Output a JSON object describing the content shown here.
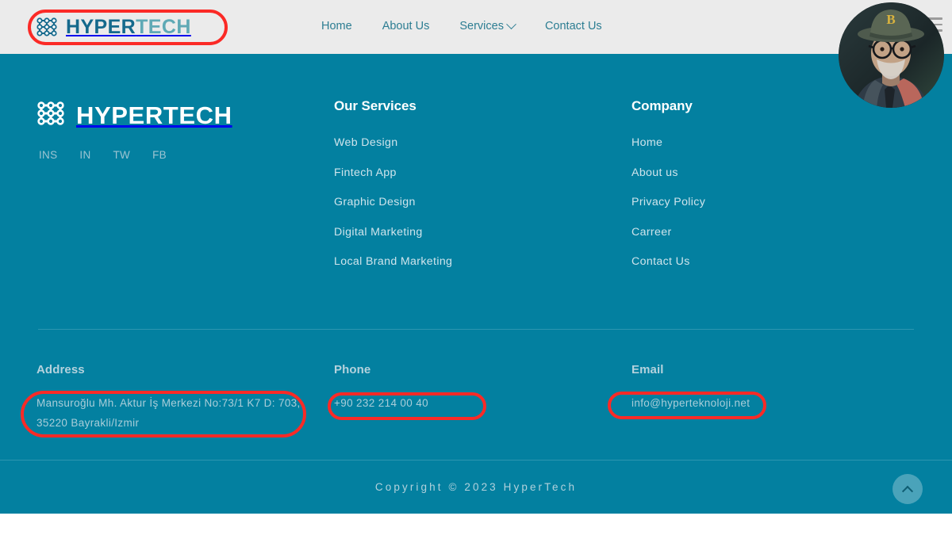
{
  "colors": {
    "header_bg": "#ebebeb",
    "footer_bg": "#0380a0",
    "brand_dark": "#15698c",
    "brand_light": "#5fa9b5",
    "nav_link": "#2c7d92",
    "annotation_red": "#fb2a26",
    "footer_link": "#cfe4ec",
    "divider": "#2d96b0",
    "totop_bg": "#4aa3ba"
  },
  "header": {
    "logo": {
      "icon": "node-grid-icon",
      "text_primary": "HYPER",
      "text_secondary": "TECH"
    },
    "nav": [
      {
        "label": "Home",
        "has_dropdown": false
      },
      {
        "label": "About Us",
        "has_dropdown": false
      },
      {
        "label": "Services",
        "has_dropdown": true,
        "caret": "chevron-down-icon"
      },
      {
        "label": "Contact Us",
        "has_dropdown": false
      }
    ],
    "menu_icon": "hamburger-menu-icon",
    "avatar": "user-avatar-elderly-man-with-glasses-and-hat"
  },
  "footer": {
    "brand": {
      "icon": "node-grid-icon",
      "text": "HYPERTECH"
    },
    "socials": [
      {
        "label": "INS",
        "name": "instagram-link"
      },
      {
        "label": "IN",
        "name": "linkedin-link"
      },
      {
        "label": "TW",
        "name": "twitter-link"
      },
      {
        "label": "FB",
        "name": "facebook-link"
      }
    ],
    "services": {
      "heading": "Our Services",
      "items": [
        "Web Design",
        "Fintech App",
        "Graphic Design",
        "Digital Marketing",
        "Local Brand Marketing"
      ]
    },
    "company": {
      "heading": "Company",
      "items": [
        "Home",
        "About us",
        "Privacy Policy",
        "Carreer",
        "Contact Us"
      ]
    },
    "contact": {
      "address": {
        "heading": "Address",
        "value": "Mansuroğlu Mh. Aktur İş Merkezi No:73/1 K7 D: 703, 35220 Bayrakli/Izmir"
      },
      "phone": {
        "heading": "Phone",
        "value": "+90 232 214 00 40"
      },
      "email": {
        "heading": "Email",
        "value": "info@hyperteknoloji.net"
      }
    },
    "copyright": "Copyright © 2023 HyperTech",
    "scroll_top_icon": "chevron-up-icon"
  },
  "annotations": [
    {
      "name": "annotation-logo",
      "target": "header-logo"
    },
    {
      "name": "annotation-address",
      "target": "footer-address-value"
    },
    {
      "name": "annotation-phone",
      "target": "footer-phone-value"
    },
    {
      "name": "annotation-email",
      "target": "footer-email-value"
    }
  ]
}
